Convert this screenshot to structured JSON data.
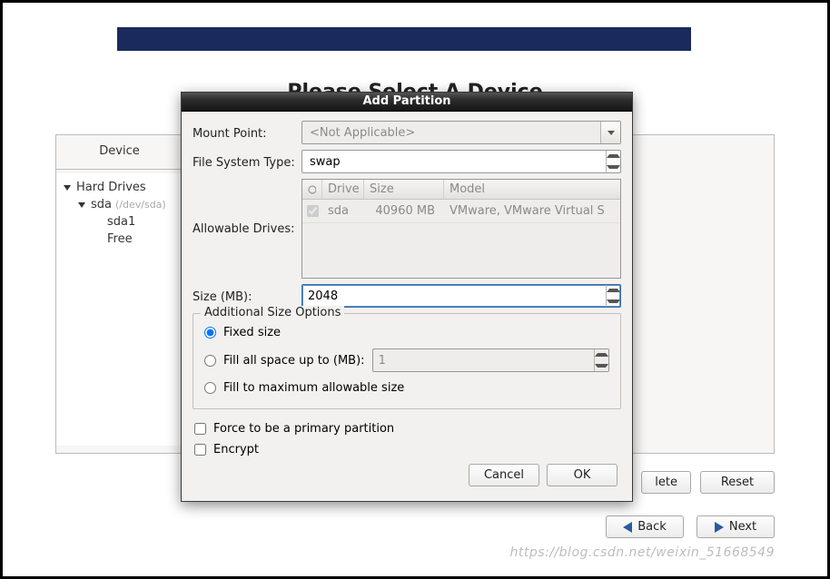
{
  "background": {
    "heading": "Please Select A Device",
    "device_col_header": "Device",
    "tree": {
      "root": "Hard Drives",
      "disk_name": "sda",
      "disk_path": "(/dev/sda)",
      "children": [
        "sda1",
        "Free"
      ]
    },
    "actions": {
      "delete": "lete",
      "reset": "Reset"
    },
    "nav": {
      "back": "Back",
      "next": "Next"
    }
  },
  "dialog": {
    "title": "Add Partition",
    "labels": {
      "mount_point": "Mount Point:",
      "fs_type": "File System Type:",
      "allowable_drives": "Allowable Drives:",
      "size_mb": "Size (MB):",
      "additional": "Additional Size Options",
      "fixed": "Fixed size",
      "fill_up_to": "Fill all space up to (MB):",
      "fill_max": "Fill to maximum allowable size",
      "force_primary": "Force to be a primary partition",
      "encrypt": "Encrypt"
    },
    "mount_point_value": "<Not Applicable>",
    "fs_type_value": "swap",
    "drives": {
      "headers": {
        "drive": "Drive",
        "size": "Size",
        "model": "Model"
      },
      "rows": [
        {
          "checked": true,
          "name": "sda",
          "size": "40960 MB",
          "model": "VMware, VMware Virtual S"
        }
      ]
    },
    "size_value": "2048",
    "size_option": "fixed",
    "fill_up_to_value": "1",
    "force_primary": false,
    "encrypt": false,
    "buttons": {
      "cancel": "Cancel",
      "ok": "OK"
    }
  },
  "watermark": "https://blog.csdn.net/weixin_51668549"
}
